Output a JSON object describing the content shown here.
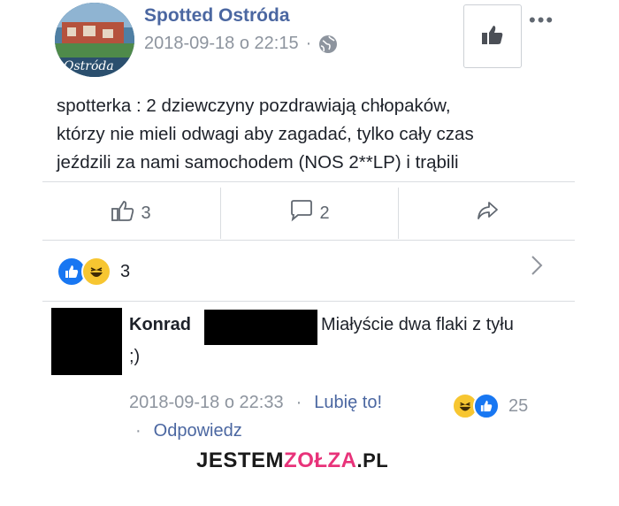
{
  "post": {
    "page_name": "Spotted Ostróda",
    "timestamp": "2018-09-18 o 22:15",
    "separator": "·",
    "avatar_text": "Ostróda",
    "text_lines": [
      "spotterka : 2 dziewczyny pozdrawiają chłopaków,",
      "którzy nie mieli odwagi aby zagadać, tylko cały czas",
      "jeździli za nami samochodem (NOS 2**LP) i trąbili"
    ]
  },
  "actions": {
    "like_count": "3",
    "comment_count": "2"
  },
  "reactions": {
    "count": "3"
  },
  "comment": {
    "author": "Konrad",
    "text_line1": "Miałyście dwa flaki z tyłu",
    "text_line2": ";)",
    "timestamp": "2018-09-18 o 22:33",
    "separator": "·",
    "like_label": "Lubię to!",
    "reaction_count": "25",
    "reply_label": "Odpowiedz"
  },
  "watermark": {
    "part1": "JESTEM",
    "part2": "ZOŁZA",
    "part3": ".PL"
  },
  "colors": {
    "link": "#4b67a1",
    "meta": "#8d949e",
    "like_blue": "#1877f2",
    "haha_yellow": "#f7c631",
    "brand_pink": "#e8337a"
  }
}
